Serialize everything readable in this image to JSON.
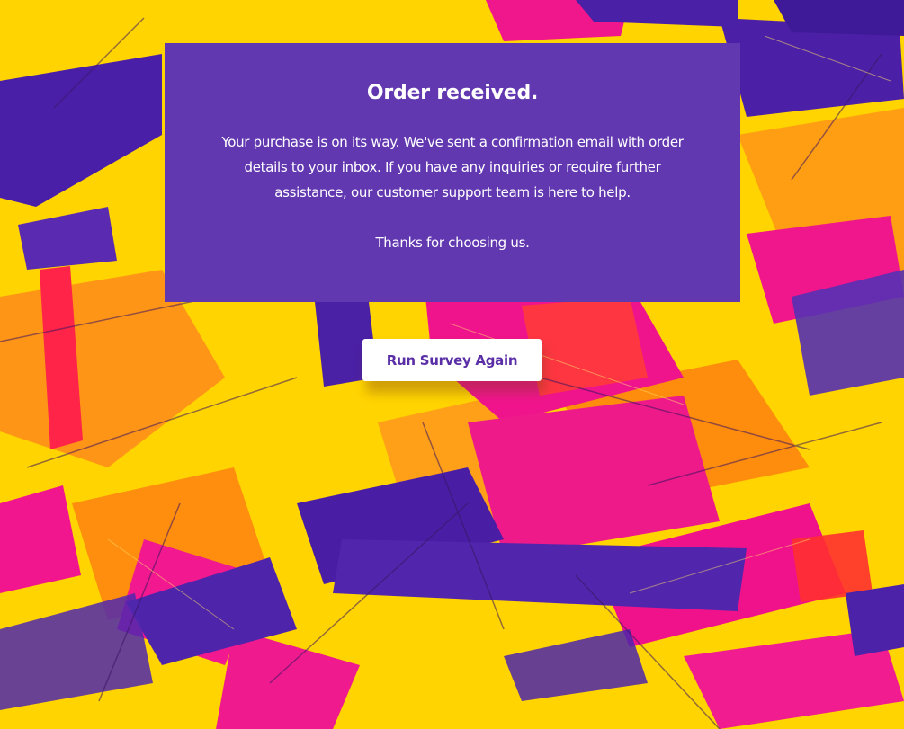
{
  "background": {
    "name": "abstract-paint-background",
    "colors": {
      "base": "#ffd400",
      "purple": "#4b1fa6",
      "magenta": "#f0148c",
      "orange": "#ff6a1a",
      "red": "#ff2a3a"
    }
  },
  "card": {
    "title": "Order received.",
    "body": "Your purchase is on its way. We've sent a confirmation email with order details to your inbox. If you have any inquiries or require further assistance, our customer support team is here to help.",
    "thanks": "Thanks for choosing us.",
    "background_color": "#6238b0"
  },
  "actions": {
    "run_again_label": "Run Survey Again"
  }
}
